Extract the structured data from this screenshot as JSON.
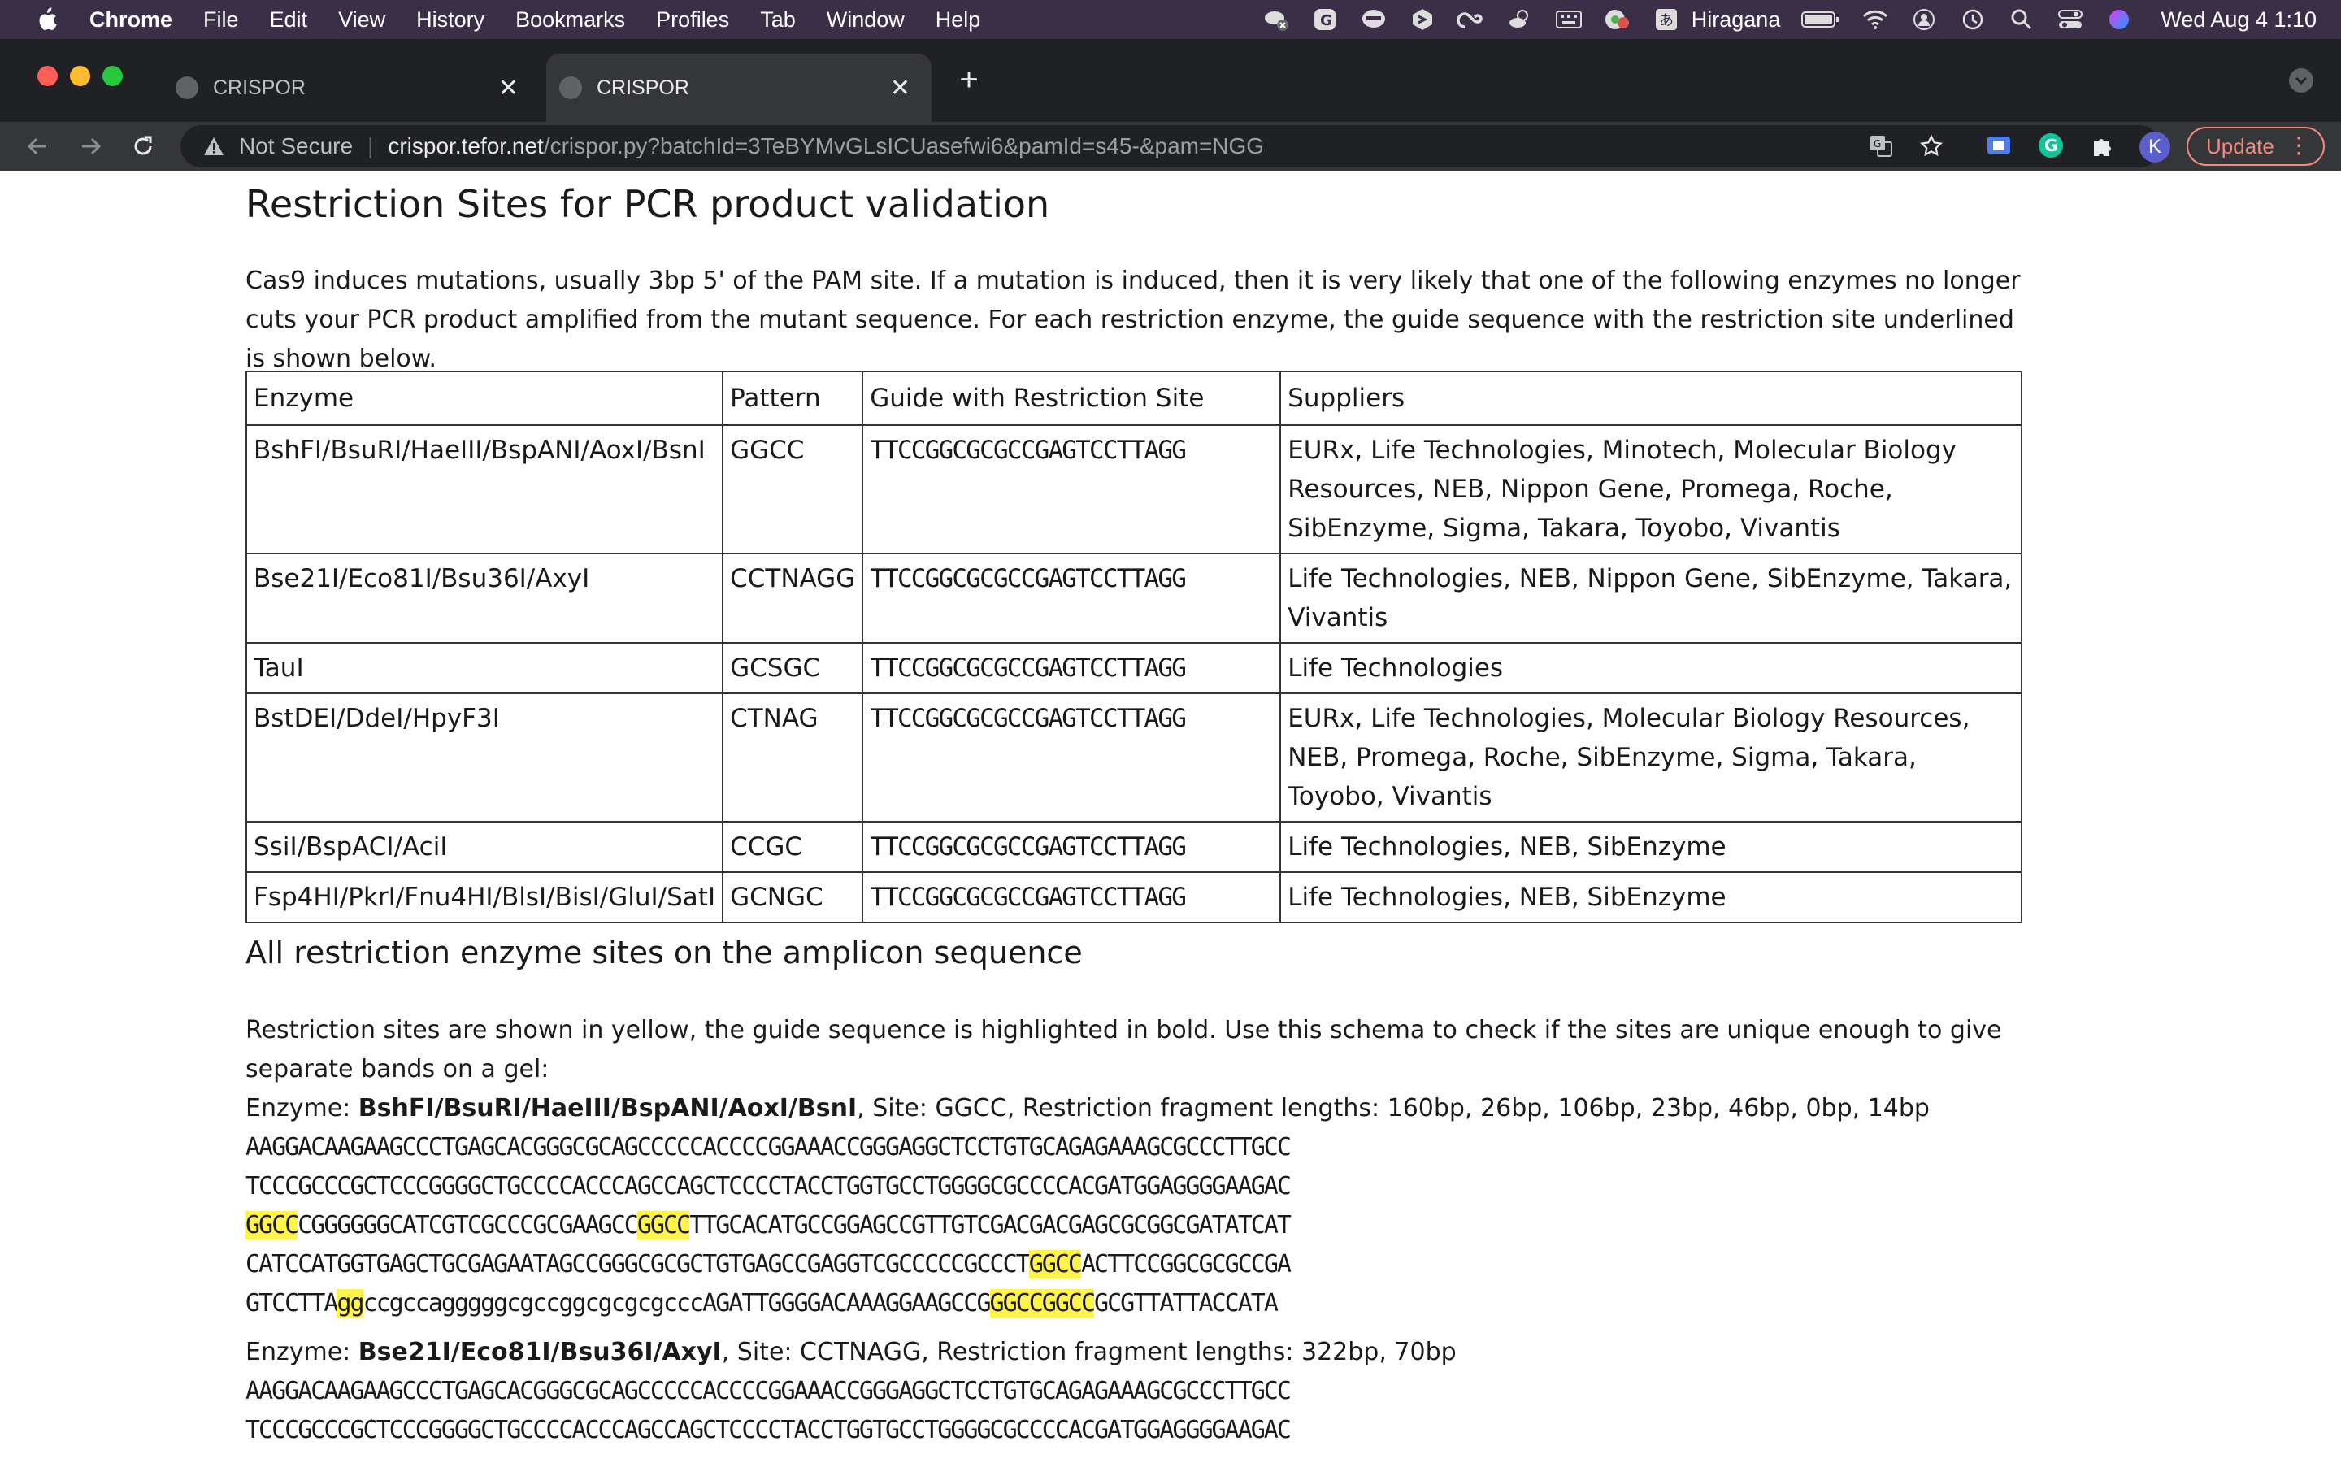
{
  "menubar": {
    "app_name": "Chrome",
    "items": [
      "File",
      "Edit",
      "View",
      "History",
      "Bookmarks",
      "Profiles",
      "Tab",
      "Window",
      "Help"
    ],
    "input_method": "Hiragana",
    "clock": "Wed Aug 4  1:10",
    "tray_icons": [
      "app-status-icon",
      "grammarly-icon",
      "line-icon",
      "app-icon",
      "creative-cloud-icon",
      "weather-icon",
      "keyboard-icon",
      "chrome-remote-icon",
      "input-method-icon",
      "battery-icon",
      "wifi-icon",
      "user-icon",
      "time-machine-icon",
      "spotlight-icon",
      "control-center-icon",
      "siri-icon"
    ]
  },
  "browser": {
    "tabs": [
      {
        "title": "CRISPOR",
        "active": false
      },
      {
        "title": "CRISPOR",
        "active": true
      }
    ],
    "security_label": "Not Secure",
    "url_host": "crispor.tefor.net",
    "url_path": "/crispor.py?batchId=3TeBYMvGLsICUasefwi6&pamId=s45-&pam=NGG",
    "profile_initial": "K",
    "update_label": "Update"
  },
  "page": {
    "section_title": "Restriction Sites for PCR product validation",
    "intro": "Cas9 induces mutations, usually 3bp 5' of the PAM site. If a mutation is induced, then it is very likely that one of the following enzymes no longer cuts your PCR product amplified from the mutant sequence. For each restriction enzyme, the guide sequence with the restriction site underlined is shown below.",
    "table": {
      "headers": [
        "Enzyme",
        "Pattern",
        "Guide with Restriction Site",
        "Suppliers"
      ],
      "rows": [
        {
          "enzyme": "BshFI/BsuRI/HaeIII/BspANI/AoxI/BsnI",
          "pattern": "GGCC",
          "guide": "TTCCGGCGCGCCGAGTCCTTAGG",
          "suppliers": "EURx, Life Technologies, Minotech, Molecular Biology Resources, NEB, Nippon Gene, Promega, Roche, SibEnzyme, Sigma, Takara, Toyobo, Vivantis"
        },
        {
          "enzyme": "Bse21I/Eco81I/Bsu36I/AxyI",
          "pattern": "CCTNAGG",
          "guide": "TTCCGGCGCGCCGAGTCCTTAGG",
          "suppliers": "Life Technologies, NEB, Nippon Gene, SibEnzyme, Takara, Vivantis"
        },
        {
          "enzyme": "TauI",
          "pattern": "GCSGC",
          "guide": "TTCCGGCGCGCCGAGTCCTTAGG",
          "suppliers": "Life Technologies"
        },
        {
          "enzyme": "BstDEI/DdeI/HpyF3I",
          "pattern": "CTNAG",
          "guide": "TTCCGGCGCGCCGAGTCCTTAGG",
          "suppliers": "EURx, Life Technologies, Molecular Biology Resources, NEB, Promega, Roche, SibEnzyme, Sigma, Takara, Toyobo, Vivantis"
        },
        {
          "enzyme": "SsiI/BspACI/AciI",
          "pattern": "CCGC",
          "guide": "TTCCGGCGCGCCGAGTCCTTAGG",
          "suppliers": "Life Technologies, NEB, SibEnzyme"
        },
        {
          "enzyme": "Fsp4HI/PkrI/Fnu4HI/BlsI/BisI/GluI/SatI",
          "pattern": "GCNGC",
          "guide": "TTCCGGCGCGCCGAGTCCTTAGG",
          "suppliers": "Life Technologies, NEB, SibEnzyme"
        }
      ]
    },
    "sub_title": "All restriction enzyme sites on the amplicon sequence",
    "intro2": "Restriction sites are shown in yellow, the guide sequence is highlighted in bold. Use this schema to check if the sites are unique enough to give separate bands on a gel:",
    "enzyme_blocks": [
      {
        "label": "Enzyme: ",
        "name": "BshFI/BsuRI/HaeIII/BspANI/AoxI/BsnI",
        "details": ", Site: GGCC, Restriction fragment lengths: 160bp, 26bp, 106bp, 23bp, 46bp, 0bp, 14bp",
        "lines": [
          [
            {
              "t": "AAGGACAAGAAGCCCTGAGCACGGGCGCAGCCCCCACCCCGGAAACCGGGAGGCTCCTGTGCAGAGAAAGCGCCCTTGCC",
              "h": false
            }
          ],
          [
            {
              "t": "TCCCGCCCGCTCCCGGGGCTGCCCCACCCAGCCAGCTCCCCTACCTGGTGCCTGGGGCGCCCCACGATGGAGGGGAAGAC",
              "h": false
            }
          ],
          [
            {
              "t": "GGCC",
              "h": true
            },
            {
              "t": "CGGGGGGCATCGTCGCCCGCGAAGCC",
              "h": false
            },
            {
              "t": "GGCC",
              "h": true
            },
            {
              "t": "TTGCACATGCCGGAGCCGTTGTCGACGACGAGCGCGGCGATATCAT",
              "h": false
            }
          ],
          [
            {
              "t": "CATCCATGGTGAGCTGCGAGAATAGCCGGGCGCGCTGTGAGCCGAGGTCGCCCCCGCCCT",
              "h": false
            },
            {
              "t": "GGCC",
              "h": true
            },
            {
              "t": "ACTTCCGGCGCGCCGA",
              "h": false
            }
          ],
          [
            {
              "t": "GTCCTTA",
              "h": false
            },
            {
              "t": "gg",
              "h": true
            },
            {
              "t": "ccgccagggggcgccggcgcgcgcccAGATTGGGGACAAAGGAAGCCG",
              "h": false
            },
            {
              "t": "GGCCGGCC",
              "h": true
            },
            {
              "t": "GCGTTATTACCATA",
              "h": false
            }
          ]
        ]
      },
      {
        "label": "Enzyme: ",
        "name": "Bse21I/Eco81I/Bsu36I/AxyI",
        "details": ", Site: CCTNAGG, Restriction fragment lengths: 322bp, 70bp",
        "lines": [
          [
            {
              "t": "AAGGACAAGAAGCCCTGAGCACGGGCGCAGCCCCCACCCCGGAAACCGGGAGGCTCCTGTGCAGAGAAAGCGCCCTTGCC",
              "h": false
            }
          ],
          [
            {
              "t": "TCCCGCCCGCTCCCGGGGCTGCCCCACCCAGCCAGCTCCCCTACCTGGTGCCTGGGGCGCCCCACGATGGAGGGGAAGAC",
              "h": false
            }
          ]
        ]
      }
    ]
  }
}
